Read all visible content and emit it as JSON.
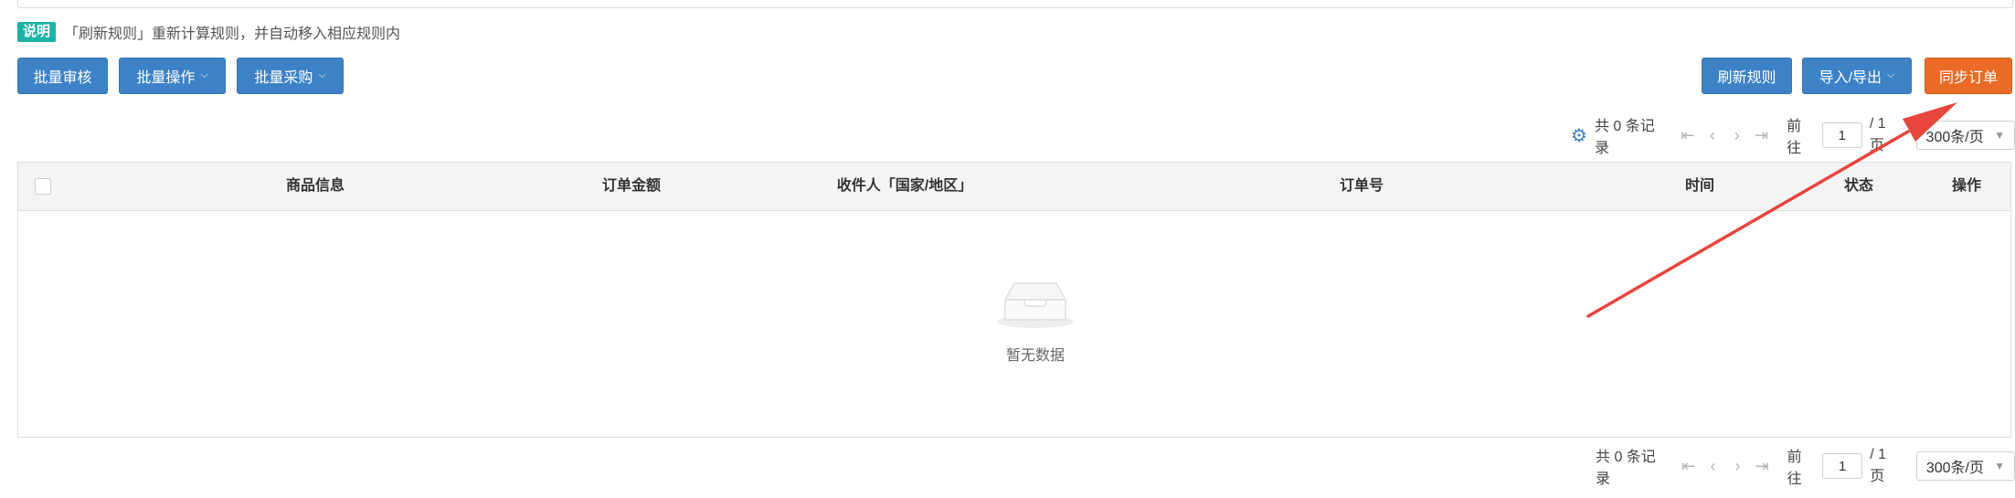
{
  "notice": {
    "tag": "说明",
    "text": "「刷新规则」重新计算规则，并自动移入相应规则内"
  },
  "toolbar": {
    "batch_review": "批量审核",
    "batch_operation": "批量操作",
    "batch_purchase": "批量采购",
    "refresh_rules": "刷新规则",
    "import_export": "导入/导出",
    "sync_orders": "同步订单"
  },
  "pagination": {
    "total": "共 0 条记录",
    "goto_label": "前往",
    "page_value": "1",
    "page_total": "/ 1 页",
    "page_size": "300条/页"
  },
  "table": {
    "columns": [
      "商品信息",
      "订单金额",
      "收件人「国家/地区」",
      "订单号",
      "时间",
      "状态",
      "操作"
    ]
  },
  "empty": {
    "text": "暂无数据"
  },
  "colors": {
    "primary_button": "#3d82c7",
    "sync_button": "#ea6b25",
    "notice_tag": "#1ab3a8",
    "annotation_arrow": "#e8453c"
  },
  "icons": {
    "settings": "gear-icon",
    "first_page": "first-page-icon",
    "prev_page": "prev-page-icon",
    "next_page": "next-page-icon",
    "last_page": "last-page-icon",
    "empty_state": "empty-inbox-icon"
  }
}
